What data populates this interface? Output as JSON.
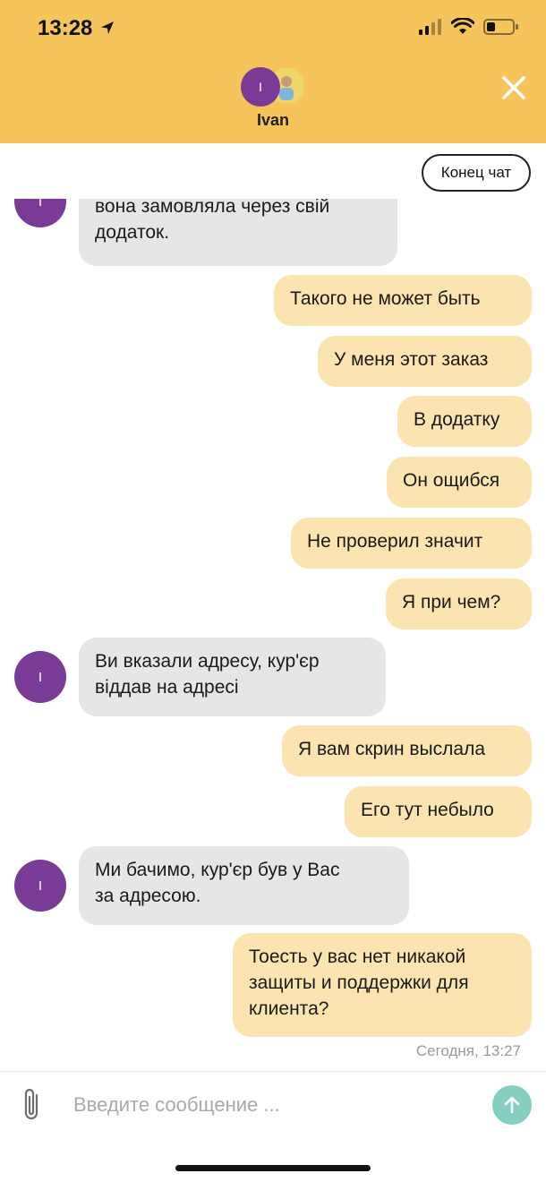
{
  "status_bar": {
    "time": "13:28"
  },
  "header": {
    "contact_name": "Ivan",
    "avatar_initial": "I"
  },
  "actions": {
    "end_chat_label": "Конец чат"
  },
  "messages": [
    {
      "from": "agent",
      "text_lines": [
        "вона замовляла через свій",
        "додаток."
      ]
    },
    {
      "from": "user",
      "text_lines": [
        "Такого не может быть"
      ]
    },
    {
      "from": "user",
      "text_lines": [
        "У меня этот заказ"
      ]
    },
    {
      "from": "user",
      "text_lines": [
        "В додатку"
      ]
    },
    {
      "from": "user",
      "text_lines": [
        "Он ощибся"
      ]
    },
    {
      "from": "user",
      "text_lines": [
        "Не проверил значит"
      ]
    },
    {
      "from": "user",
      "text_lines": [
        "Я при чем?"
      ]
    },
    {
      "from": "agent",
      "text_lines": [
        "Ви вказали адресу, кур'єр",
        "віддав на адресі"
      ]
    },
    {
      "from": "user",
      "text_lines": [
        "Я вам скрин выслала"
      ]
    },
    {
      "from": "user",
      "text_lines": [
        "Его тут небыло"
      ]
    },
    {
      "from": "agent",
      "text_lines": [
        "Ми бачимо, кур'єр був у Вас",
        "за адресою."
      ]
    },
    {
      "from": "user",
      "text_lines": [
        "Тоесть у вас нет никакой",
        "защиты и поддержки для",
        "клиента?"
      ]
    }
  ],
  "last_timestamp": "Сегодня, 13:27",
  "composer": {
    "placeholder": "Введите сообщение ..."
  },
  "colors": {
    "header_bg": "#F5C45B",
    "user_bubble": "#FBE4B0",
    "agent_bubble": "#E6E6E6",
    "avatar": "#7A3B96",
    "send_button": "#84CFC0"
  },
  "icons": {
    "status": [
      "location-arrow-icon",
      "signal-icon",
      "wifi-icon",
      "battery-icon"
    ],
    "close": "close-icon",
    "attach": "paperclip-icon",
    "send": "arrow-up-icon"
  }
}
